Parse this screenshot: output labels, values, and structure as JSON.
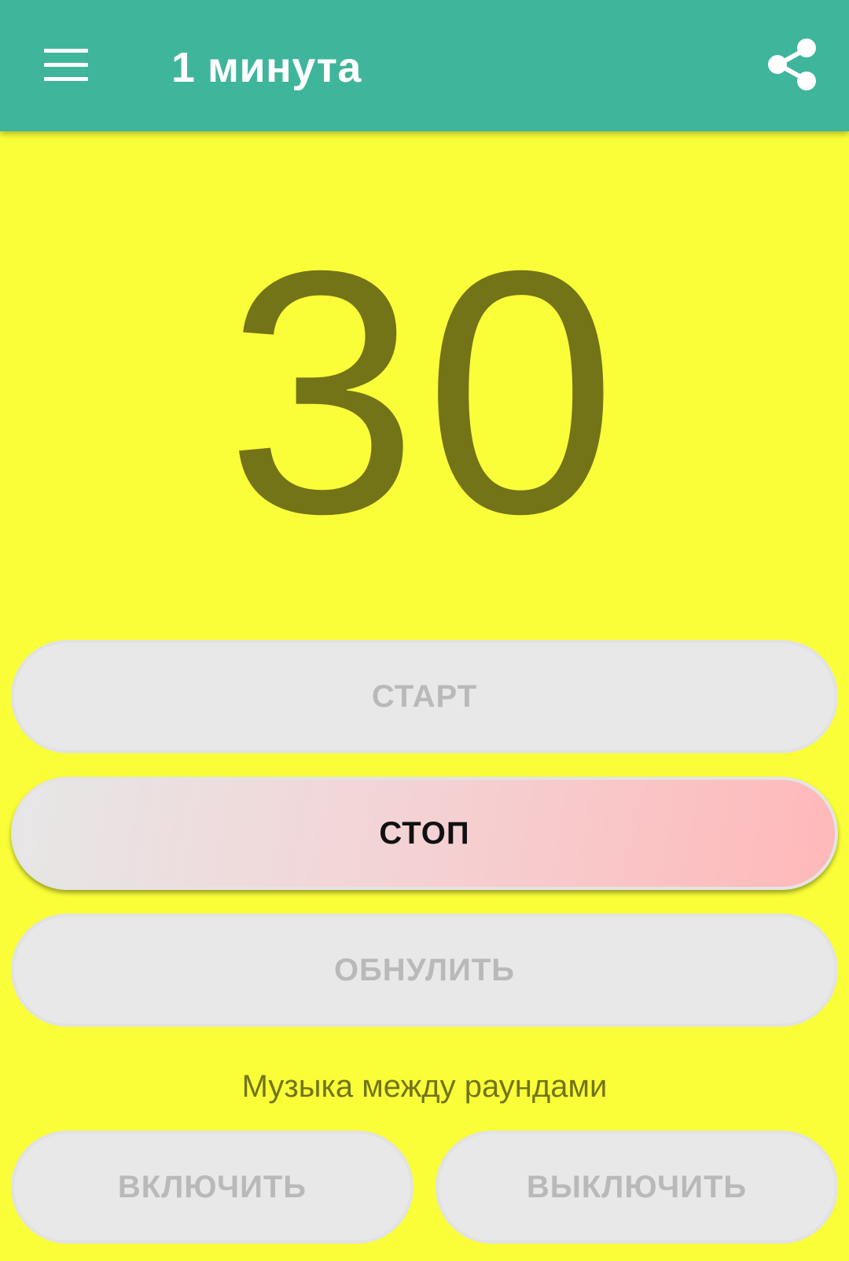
{
  "app_bar": {
    "title": "1 минута",
    "menu_icon": "hamburger-menu-icon",
    "share_icon": "share-icon",
    "background_color": "#3fb59c"
  },
  "timer": {
    "value": "30",
    "color": "#737417"
  },
  "background_color": "#f9fe38",
  "buttons": {
    "start": "СТАРТ",
    "stop": "СТОП",
    "reset": "ОБНУЛИТЬ"
  },
  "music": {
    "label": "Музыка между раундами",
    "enable": "ВКЛЮЧИТЬ",
    "disable": "ВЫКЛЮЧИТЬ"
  }
}
